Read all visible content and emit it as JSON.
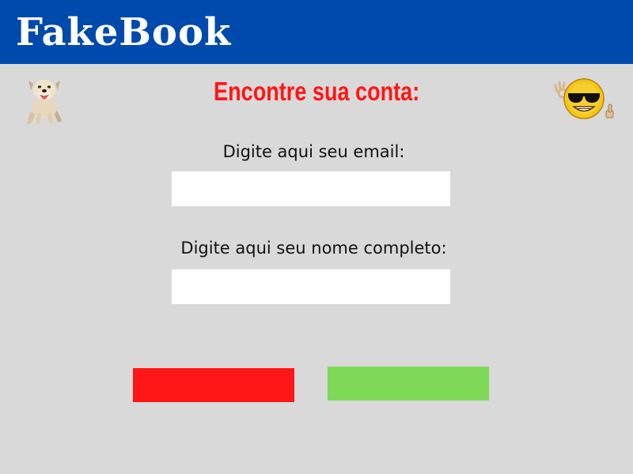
{
  "header": {
    "brand": "FakeBook",
    "background_color": "#004aad"
  },
  "main": {
    "title": "Encontre sua conta:",
    "title_color": "#ff1616",
    "email_label": "Digite aqui seu email:",
    "email_value": "",
    "name_label": "Digite aqui seu nome completo:",
    "name_value": ""
  },
  "buttons": {
    "cancel_color": "#ff1616",
    "confirm_color": "#7ed957"
  },
  "images": {
    "left": "dog-icon",
    "right": "cool-emoji-thumbs-up-icon"
  },
  "page": {
    "background_color": "#d9d9d9"
  }
}
